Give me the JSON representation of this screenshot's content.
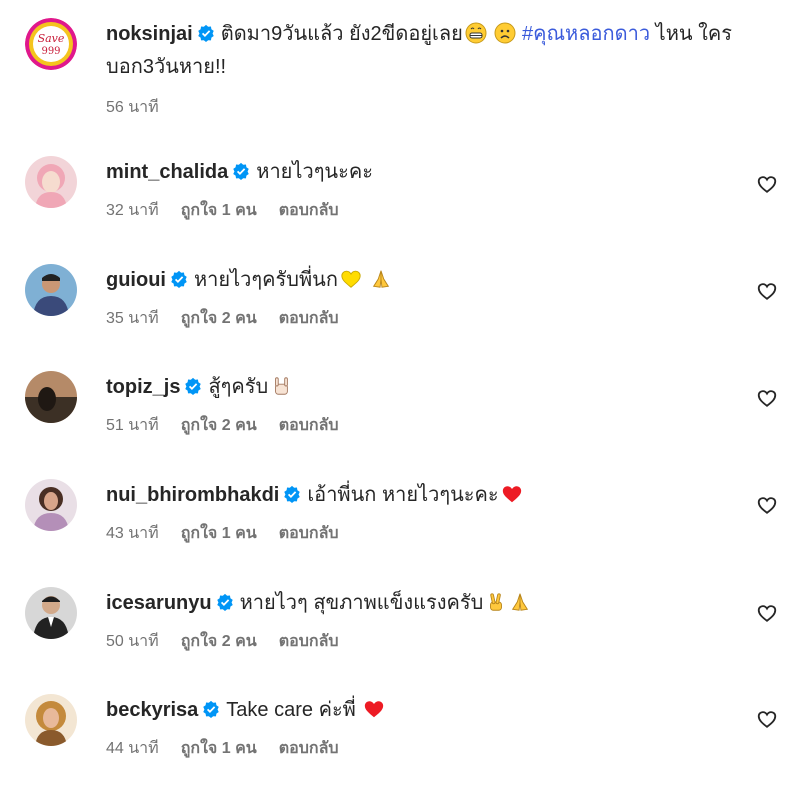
{
  "comments": [
    {
      "username": "noksinjai",
      "text_before": "ติดมา9วันแล้ว ยัง2ขีดอยู่เลย",
      "hashtag": "#คุณหลอกดาว",
      "text_after": " ไหน ใครบอก3วันหาย!!",
      "time": "56 นาที",
      "avatar_text": "Save 999",
      "emojis": [
        "grimace-emoji",
        "worried-emoji"
      ]
    },
    {
      "username": "mint_chalida",
      "text": "หายไวๆนะคะ",
      "time": "32 นาที",
      "likes": "ถูกใจ 1 คน",
      "reply": "ตอบกลับ"
    },
    {
      "username": "guioui",
      "text": "หายไวๆครับพี่นก",
      "time": "35 นาที",
      "likes": "ถูกใจ 2 คน",
      "reply": "ตอบกลับ",
      "emojis": [
        "yellow-heart-emoji",
        "folded-hands-emoji"
      ]
    },
    {
      "username": "topiz_js",
      "text": "สู้ๆครับ",
      "time": "51 นาที",
      "likes": "ถูกใจ 2 คน",
      "reply": "ตอบกลับ",
      "emojis": [
        "rock-hand-emoji"
      ]
    },
    {
      "username": "nui_bhirombhakdi",
      "text": "เอ้าพี่นก หายไวๆนะคะ",
      "time": "43 นาที",
      "likes": "ถูกใจ 1 คน",
      "reply": "ตอบกลับ",
      "emojis": [
        "red-heart-emoji"
      ]
    },
    {
      "username": "icesarunyu",
      "text": "หายไวๆ สุขภาพแข็งแรงครับ",
      "time": "50 นาที",
      "likes": "ถูกใจ 2 คน",
      "reply": "ตอบกลับ",
      "emojis": [
        "victory-hand-emoji",
        "folded-hands-emoji"
      ]
    },
    {
      "username": "beckyrisa",
      "text": "Take care ค่ะพี่",
      "time": "44 นาที",
      "likes": "ถูกใจ 1 คน",
      "reply": "ตอบกลับ",
      "emojis": [
        "red-heart-emoji"
      ]
    }
  ],
  "colors": {
    "verified": "#0095f6",
    "muted": "#737373",
    "hashtag": "#3b5bdb",
    "heart_red": "#ed1b24"
  }
}
